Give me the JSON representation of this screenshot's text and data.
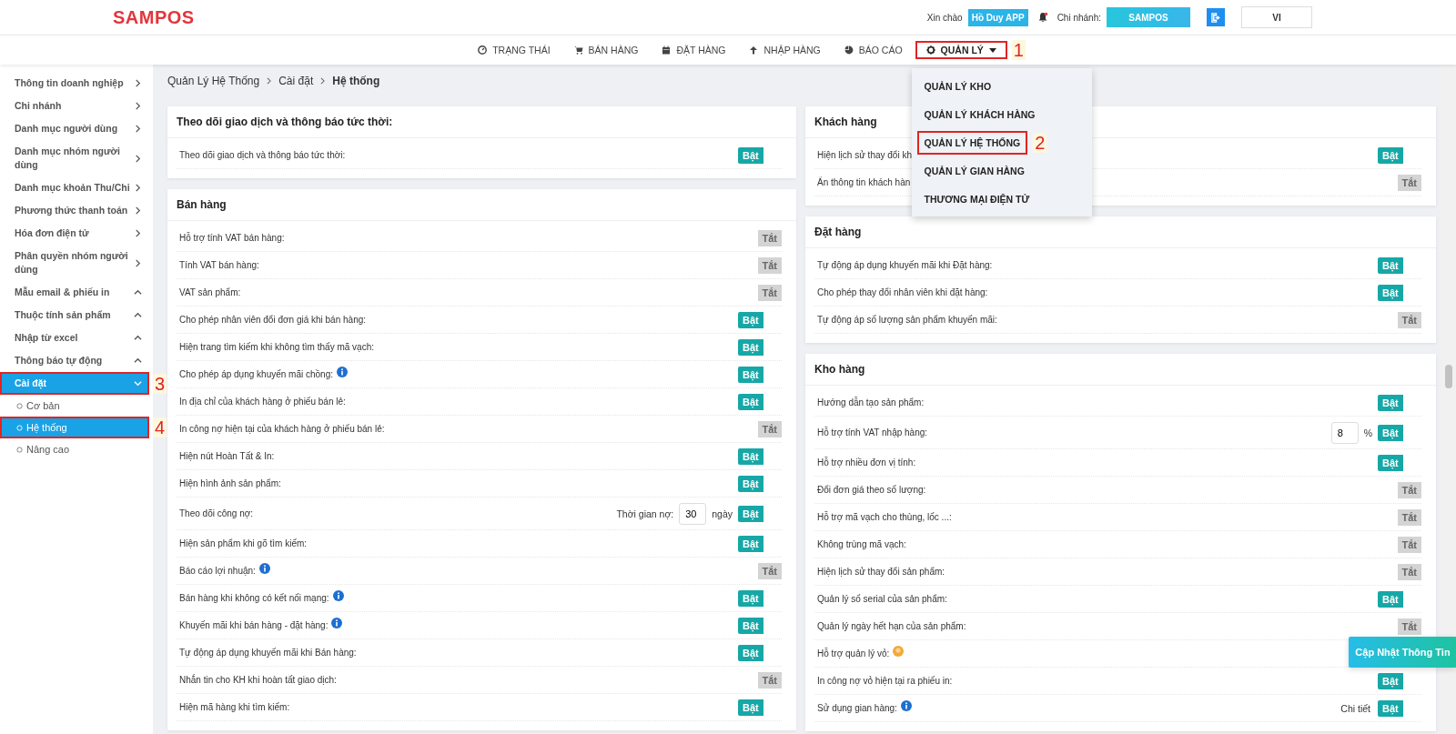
{
  "header": {
    "logo": "SAMPOS",
    "greeting": "Xin chào",
    "user": "Hồ Duy APP",
    "branch_label": "Chi nhánh:",
    "branch": "SAMPOS",
    "language": "VI"
  },
  "nav": [
    {
      "label": "TRẠNG THÁI",
      "open": false
    },
    {
      "label": "BÁN HÀNG",
      "open": false
    },
    {
      "label": "ĐẶT HÀNG",
      "open": false
    },
    {
      "label": "NHẬP HÀNG",
      "open": false
    },
    {
      "label": "BÁO CÁO",
      "open": false
    },
    {
      "label": "QUẢN LÝ",
      "open": true,
      "callout": "1"
    }
  ],
  "menu": [
    {
      "label": "QUẢN LÝ KHO"
    },
    {
      "label": "QUẢN LÝ KHÁCH HÀNG"
    },
    {
      "label": "QUẢN LÝ HỆ THỐNG",
      "callout": "2"
    },
    {
      "label": "QUẢN LÝ GIAN HÀNG"
    },
    {
      "label": "THƯƠNG MẠI ĐIỆN TỬ"
    }
  ],
  "sidebar": [
    {
      "label": "Thông tin doanh nghiệp",
      "kind": "page",
      "selected": false
    },
    {
      "label": "Chi nhánh",
      "kind": "page",
      "selected": false
    },
    {
      "label": "Danh mục người dùng",
      "kind": "page",
      "selected": false
    },
    {
      "label": "Danh mục nhóm người dùng",
      "kind": "page",
      "selected": false
    },
    {
      "label": "Danh mục khoản Thu/Chi",
      "kind": "page",
      "selected": false
    },
    {
      "label": "Phương thức thanh toán",
      "kind": "page",
      "selected": false
    },
    {
      "label": "Hóa đơn điện tử",
      "kind": "page",
      "selected": false
    },
    {
      "label": "Phân quyền nhóm người dùng",
      "kind": "page",
      "selected": false
    },
    {
      "label": "Mẫu email & phiếu in",
      "kind": "group",
      "expanded": false,
      "selected": false
    },
    {
      "label": "Thuộc tính sản phẩm",
      "kind": "group",
      "expanded": false,
      "selected": false
    },
    {
      "label": "Nhập từ excel",
      "kind": "group",
      "expanded": false,
      "selected": false
    },
    {
      "label": "Thông báo tự động",
      "kind": "group",
      "expanded": false,
      "selected": false
    },
    {
      "label": "Cài đặt",
      "kind": "group",
      "expanded": true,
      "selected": true,
      "callout": "3",
      "children": [
        {
          "label": "Cơ bản",
          "selected": false
        },
        {
          "label": "Hệ thống",
          "selected": true,
          "callout": "4"
        },
        {
          "label": "Nâng cao",
          "selected": false
        }
      ]
    }
  ],
  "breadcrumb": [
    "Quản Lý Hệ Thống",
    "Cài đặt",
    "Hệ thống"
  ],
  "columns": [
    [
      {
        "title": "Theo dõi giao dịch và thông báo tức thời:",
        "rows": [
          {
            "label": "Theo dõi giao dịch và thông báo tức thời:",
            "toggle": "Bật",
            "on": true
          }
        ]
      },
      {
        "title": "Bán hàng",
        "rows": [
          {
            "label": "Hỗ trợ tính VAT bán hàng:",
            "toggle": "Tắt",
            "on": false
          },
          {
            "label": "Tính VAT bán hàng:",
            "toggle": "Tắt",
            "on": false
          },
          {
            "label": "VAT sản phẩm:",
            "toggle": "Tắt",
            "on": false
          },
          {
            "label": "Cho phép nhân viên đổi đơn giá khi bán hàng:",
            "toggle": "Bật",
            "on": true
          },
          {
            "label": "Hiện trang tìm kiếm khi không tìm thấy mã vạch:",
            "toggle": "Bật",
            "on": true
          },
          {
            "label": "Cho phép áp dụng khuyến mãi chồng:",
            "kind": "info",
            "toggle": "Bật",
            "on": true
          },
          {
            "label": "In địa chỉ của khách hàng ở phiếu bán lẻ:",
            "toggle": "Bật",
            "on": true
          },
          {
            "label": "In công nợ hiện tại của khách hàng ở phiếu bán lẻ:",
            "toggle": "Tắt",
            "on": false
          },
          {
            "label": "Hiện nút Hoàn Tất & In:",
            "toggle": "Bật",
            "on": true
          },
          {
            "label": "Hiện hình ảnh sản phẩm:",
            "toggle": "Bật",
            "on": true
          },
          {
            "label": "Theo dõi công nợ:",
            "input": {
              "prefix": "Thời gian nợ:",
              "value": "30",
              "suffix": "ngày"
            },
            "toggle": "Bật",
            "on": true
          },
          {
            "label": "Hiện sản phẩm khi gõ tìm kiếm:",
            "toggle": "Bật",
            "on": true
          },
          {
            "label": "Báo cáo lợi nhuận:",
            "kind": "info",
            "toggle": "Tắt",
            "on": false
          },
          {
            "label": "Bán hàng khi không có kết nối mạng:",
            "kind": "info",
            "toggle": "Bật",
            "on": true
          },
          {
            "label": "Khuyến mãi khi bán hàng - đặt hàng:",
            "kind": "info",
            "toggle": "Bật",
            "on": true
          },
          {
            "label": "Tự động áp dụng khuyến mãi khi Bán hàng:",
            "toggle": "Bật",
            "on": true
          },
          {
            "label": "Nhắn tin cho KH khi hoàn tất giao dịch:",
            "toggle": "Tắt",
            "on": false
          },
          {
            "label": "Hiện mã hàng khi tìm kiếm:",
            "toggle": "Bật",
            "on": true
          }
        ]
      }
    ],
    [
      {
        "title": "Khách hàng",
        "rows": [
          {
            "label": "Hiện lịch sử thay đổi kh",
            "toggle": "Bật",
            "on": true
          },
          {
            "label": "Ẩn thông tin khách hàn",
            "toggle": "Tắt",
            "on": false
          }
        ]
      },
      {
        "title": "Đặt hàng",
        "rows": [
          {
            "label": "Tự động áp dụng khuyến mãi khi Đặt hàng:",
            "toggle": "Bật",
            "on": true
          },
          {
            "label": "Cho phép thay đổi nhân viên khi đặt hàng:",
            "toggle": "Bật",
            "on": true
          },
          {
            "label": "Tự động áp số lượng sản phẩm khuyến mãi:",
            "toggle": "Tắt",
            "on": false
          }
        ]
      },
      {
        "title": "Kho hàng",
        "rows": [
          {
            "label": "Hướng dẫn tạo sản phẩm:",
            "toggle": "Bật",
            "on": true
          },
          {
            "label": "Hỗ trợ tính VAT nhập hàng:",
            "input": {
              "value": "8",
              "suffix": "%"
            },
            "toggle": "Bật",
            "on": true
          },
          {
            "label": "Hỗ trợ nhiều đơn vị tính:",
            "toggle": "Bật",
            "on": true
          },
          {
            "label": "Đổi đơn giá theo số lượng:",
            "toggle": "Tắt",
            "on": false
          },
          {
            "label": "Hỗ trợ mã vạch cho thùng, lốc ...:",
            "toggle": "Tắt",
            "on": false
          },
          {
            "label": "Không trùng mã vạch:",
            "toggle": "Tắt",
            "on": false
          },
          {
            "label": "Hiện lịch sử thay đổi sản phẩm:",
            "toggle": "Tắt",
            "on": false
          },
          {
            "label": "Quản lý số serial của sản phẩm:",
            "toggle": "Bật",
            "on": true
          },
          {
            "label": "Quản lý ngày hết hạn của sản phẩm:",
            "toggle": "Tắt",
            "on": false
          },
          {
            "label": "Hỗ trợ quản lý vỏ:",
            "kind": "hint"
          },
          {
            "label": "In công nợ vỏ hiện tại ra phiếu in:",
            "toggle": "Bật",
            "on": true
          },
          {
            "label": "Sử dụng gian hàng:",
            "kind": "info",
            "link": "Chi tiết",
            "toggle": "Bật",
            "on": true
          }
        ]
      }
    ]
  ],
  "floating_button": "Cập Nhật Thông Tin"
}
